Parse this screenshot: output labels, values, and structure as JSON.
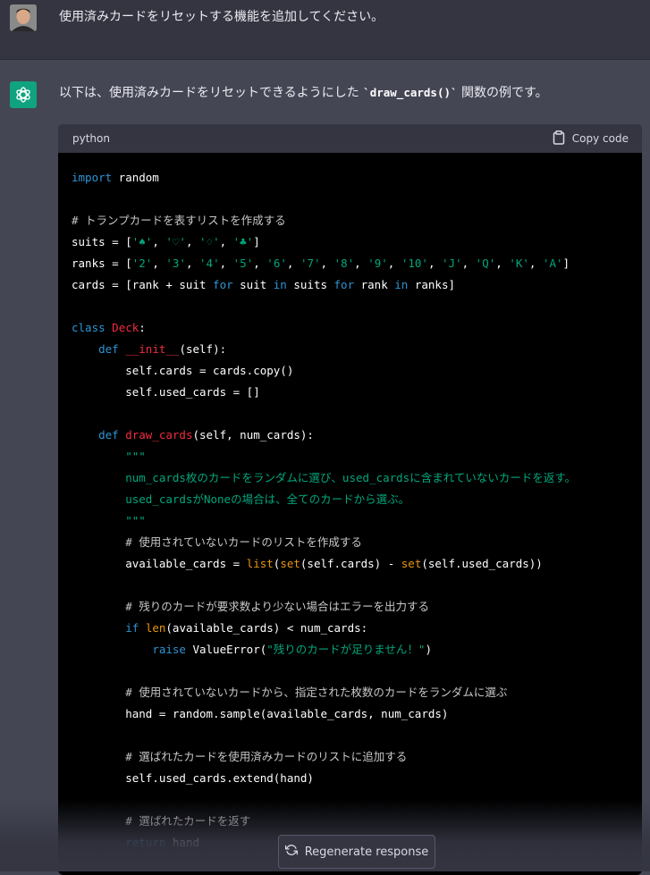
{
  "user_message": {
    "text": "使用済みカードをリセットする機能を追加してください。"
  },
  "assistant_message": {
    "text_before": "以下は、使用済みカードをリセットできるようにした ",
    "inline_code": "`draw_cards()`",
    "text_after": " 関数の例です。"
  },
  "code_block": {
    "language": "python",
    "copy_label": "Copy code",
    "lines": [
      [
        {
          "t": "import",
          "c": "kw"
        },
        {
          "t": " random"
        }
      ],
      [],
      [
        {
          "t": "# トランプカードを表すリストを作成する",
          "c": "cmt"
        }
      ],
      [
        {
          "t": "suits = ["
        },
        {
          "t": "'♠'",
          "c": "str"
        },
        {
          "t": ", "
        },
        {
          "t": "'♡'",
          "c": "str"
        },
        {
          "t": ", "
        },
        {
          "t": "'♢'",
          "c": "str"
        },
        {
          "t": ", "
        },
        {
          "t": "'♣'",
          "c": "str"
        },
        {
          "t": "]"
        }
      ],
      [
        {
          "t": "ranks = ["
        },
        {
          "t": "'2'",
          "c": "str"
        },
        {
          "t": ", "
        },
        {
          "t": "'3'",
          "c": "str"
        },
        {
          "t": ", "
        },
        {
          "t": "'4'",
          "c": "str"
        },
        {
          "t": ", "
        },
        {
          "t": "'5'",
          "c": "str"
        },
        {
          "t": ", "
        },
        {
          "t": "'6'",
          "c": "str"
        },
        {
          "t": ", "
        },
        {
          "t": "'7'",
          "c": "str"
        },
        {
          "t": ", "
        },
        {
          "t": "'8'",
          "c": "str"
        },
        {
          "t": ", "
        },
        {
          "t": "'9'",
          "c": "str"
        },
        {
          "t": ", "
        },
        {
          "t": "'10'",
          "c": "str"
        },
        {
          "t": ", "
        },
        {
          "t": "'J'",
          "c": "str"
        },
        {
          "t": ", "
        },
        {
          "t": "'Q'",
          "c": "str"
        },
        {
          "t": ", "
        },
        {
          "t": "'K'",
          "c": "str"
        },
        {
          "t": ", "
        },
        {
          "t": "'A'",
          "c": "str"
        },
        {
          "t": "]"
        }
      ],
      [
        {
          "t": "cards = [rank + suit "
        },
        {
          "t": "for",
          "c": "kw"
        },
        {
          "t": " suit "
        },
        {
          "t": "in",
          "c": "kw"
        },
        {
          "t": " suits "
        },
        {
          "t": "for",
          "c": "kw"
        },
        {
          "t": " rank "
        },
        {
          "t": "in",
          "c": "kw"
        },
        {
          "t": " ranks]"
        }
      ],
      [],
      [
        {
          "t": "class",
          "c": "kw"
        },
        {
          "t": " "
        },
        {
          "t": "Deck",
          "c": "cls"
        },
        {
          "t": ":"
        }
      ],
      [
        {
          "t": "    "
        },
        {
          "t": "def",
          "c": "kw"
        },
        {
          "t": " "
        },
        {
          "t": "__init__",
          "c": "fn"
        },
        {
          "t": "(self):"
        }
      ],
      [
        {
          "t": "        self.cards = cards.copy()"
        }
      ],
      [
        {
          "t": "        self.used_cards = []"
        }
      ],
      [],
      [
        {
          "t": "    "
        },
        {
          "t": "def",
          "c": "kw"
        },
        {
          "t": " "
        },
        {
          "t": "draw_cards",
          "c": "fn"
        },
        {
          "t": "(self, num_cards):"
        }
      ],
      [
        {
          "t": "        \"\"\"",
          "c": "str"
        }
      ],
      [
        {
          "t": "        num_cards枚のカードをランダムに選び、used_cardsに含まれていないカードを返す。",
          "c": "str"
        }
      ],
      [
        {
          "t": "        used_cardsがNoneの場合は、全てのカードから選ぶ。",
          "c": "str"
        }
      ],
      [
        {
          "t": "        \"\"\"",
          "c": "str"
        }
      ],
      [
        {
          "t": "        "
        },
        {
          "t": "# 使用されていないカードのリストを作成する",
          "c": "cmt"
        }
      ],
      [
        {
          "t": "        available_cards = "
        },
        {
          "t": "list",
          "c": "bi"
        },
        {
          "t": "("
        },
        {
          "t": "set",
          "c": "bi"
        },
        {
          "t": "(self.cards) - "
        },
        {
          "t": "set",
          "c": "bi"
        },
        {
          "t": "(self.used_cards))"
        }
      ],
      [],
      [
        {
          "t": "        "
        },
        {
          "t": "# 残りのカードが要求数より少ない場合はエラーを出力する",
          "c": "cmt"
        }
      ],
      [
        {
          "t": "        "
        },
        {
          "t": "if",
          "c": "kw"
        },
        {
          "t": " "
        },
        {
          "t": "len",
          "c": "bi"
        },
        {
          "t": "(available_cards) < num_cards:"
        }
      ],
      [
        {
          "t": "            "
        },
        {
          "t": "raise",
          "c": "kw"
        },
        {
          "t": " ValueError("
        },
        {
          "t": "\"残りのカードが足りません！\"",
          "c": "str"
        },
        {
          "t": ")"
        }
      ],
      [],
      [
        {
          "t": "        "
        },
        {
          "t": "# 使用されていないカードから、指定された枚数のカードをランダムに選ぶ",
          "c": "cmt"
        }
      ],
      [
        {
          "t": "        hand = random.sample(available_cards, num_cards)"
        }
      ],
      [],
      [
        {
          "t": "        "
        },
        {
          "t": "# 選ばれたカードを使用済みカードのリストに追加する",
          "c": "cmt"
        }
      ],
      [
        {
          "t": "        self.used_cards.extend(hand)"
        }
      ],
      [],
      [
        {
          "t": "        "
        },
        {
          "t": "# 選ばれたカードを返す",
          "c": "cmt"
        }
      ],
      [
        {
          "t": "        "
        },
        {
          "t": "return",
          "c": "kw"
        },
        {
          "t": " hand"
        }
      ]
    ]
  },
  "regenerate_button": {
    "label": "Regenerate response"
  },
  "colors": {
    "gpt_green": "#10a37f",
    "keyword": "#2e95d3",
    "string": "#00a67d",
    "function": "#f22c3d",
    "builtin": "#e9950c"
  },
  "icons": [
    "user-avatar",
    "chatgpt-logo-icon",
    "clipboard-icon",
    "refresh-icon"
  ]
}
